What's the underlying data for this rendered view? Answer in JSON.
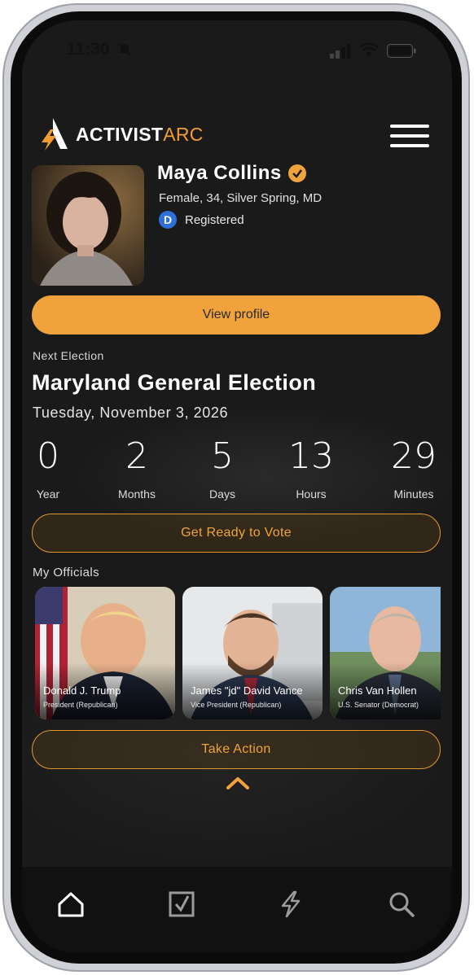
{
  "status_bar": {
    "time": "11:30"
  },
  "brand": {
    "logo_bold": "ACTIVIST",
    "logo_light": "ARC",
    "accent_color": "#f39c32"
  },
  "profile": {
    "name": "Maya Collins",
    "details": "Female, 34, Silver Spring, MD",
    "party_letter": "D",
    "registration_status": "Registered",
    "view_profile_label": "View profile"
  },
  "election": {
    "section_label": "Next Election",
    "title": "Maryland General Election",
    "date": "Tuesday, November 3, 2026"
  },
  "countdown": [
    {
      "value": "0",
      "unit": "Year"
    },
    {
      "value": "2",
      "unit": "Months"
    },
    {
      "value": "5",
      "unit": "Days"
    },
    {
      "value": "13",
      "unit": "Hours"
    },
    {
      "value": "29",
      "unit": "Minutes"
    }
  ],
  "get_ready_label": "Get Ready to Vote",
  "officials": {
    "section_label": "My Officials",
    "items": [
      {
        "name": "Donald J. Trump",
        "title": "President (Republican)"
      },
      {
        "name": "James \"jd\" David Vance",
        "title": "Vice President (Republican)"
      },
      {
        "name": "Chris Van Hollen",
        "title": "U.S. Senator (Democrat)"
      }
    ]
  },
  "take_action_label": "Take Action",
  "bottom_nav": [
    {
      "icon": "home-icon"
    },
    {
      "icon": "checkbox-icon"
    },
    {
      "icon": "lightning-icon"
    },
    {
      "icon": "search-icon"
    }
  ]
}
